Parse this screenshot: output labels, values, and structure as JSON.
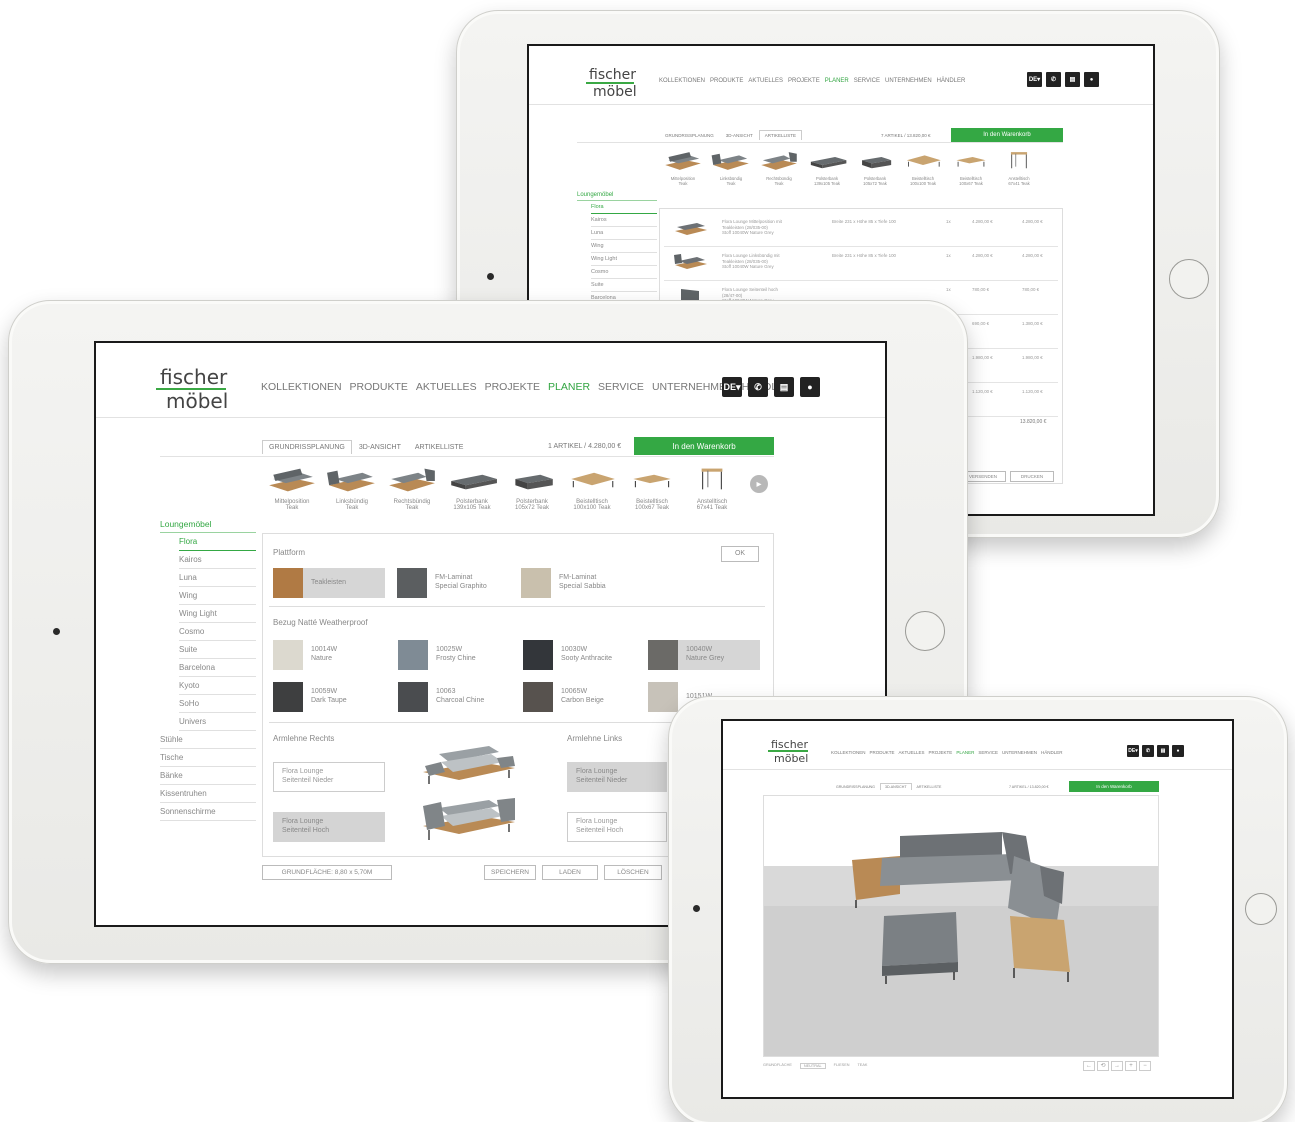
{
  "brand": {
    "line1": "fischer",
    "line2": "möbel",
    "accent": "#34a844"
  },
  "nav": {
    "items": [
      "KOLLEKTIONEN",
      "PRODUKTE",
      "AKTUELLES",
      "PROJEKTE",
      "PLANER",
      "SERVICE",
      "UNTERNEHMEN",
      "HÄNDLER"
    ],
    "active": "PLANER"
  },
  "header_buttons": {
    "lang": "DE▾",
    "phone_icon": "phone-icon",
    "cart_icon": "cart-icon",
    "user_icon": "user-icon"
  },
  "planner": {
    "tabs": [
      "GRUNDRISSPLANUNG",
      "3D-ANSICHT",
      "ARTIKELLISTE"
    ],
    "cart_count": "1 ARTIKEL / 4.280,00 €",
    "cart_button": "In den Warenkorb",
    "products": [
      {
        "line1": "Mittelposition",
        "line2": "Teak"
      },
      {
        "line1": "Linksbündig",
        "line2": "Teak"
      },
      {
        "line1": "Rechtsbündig",
        "line2": "Teak"
      },
      {
        "line1": "Polsterbank",
        "line2": "139x105 Teak"
      },
      {
        "line1": "Polsterbank",
        "line2": "105x72 Teak"
      },
      {
        "line1": "Beistelltisch",
        "line2": "100x100 Teak"
      },
      {
        "line1": "Beistelltisch",
        "line2": "100x67 Teak"
      },
      {
        "line1": "Anstelltisch",
        "line2": "67x41 Teak"
      }
    ],
    "categories": {
      "title": "Loungemöbel",
      "active_sub": "Flora",
      "subs": [
        "Flora",
        "Kairos",
        "Luna",
        "Wing",
        "Wing Light",
        "Cosmo",
        "Suite",
        "Barcelona",
        "Kyoto",
        "SoHo",
        "Univers"
      ],
      "others": [
        "Stühle",
        "Tische",
        "Bänke",
        "Kissentruhen",
        "Sonnenschirme"
      ]
    },
    "config": {
      "platform_title": "Plattform",
      "ok_label": "OK",
      "platform_options": [
        {
          "label": "Teakleisten",
          "color": "#b07a44",
          "selected": true
        },
        {
          "label": "FM-Laminat\nSpecial Graphito",
          "color": "#5b5e60",
          "selected": false
        },
        {
          "label": "FM-Laminat\nSpecial Sabbia",
          "color": "#c9c0ad",
          "selected": false
        }
      ],
      "fabric_title": "Bezug Natté Weatherproof",
      "fabric_options": [
        {
          "label": "10014W\nNature",
          "color": "#dcd9cf",
          "selected": false
        },
        {
          "label": "10025W\nFrosty Chine",
          "color": "#7f8b95",
          "selected": false
        },
        {
          "label": "10030W\nSooty Anthracite",
          "color": "#33363a",
          "selected": false
        },
        {
          "label": "10040W\nNature Grey",
          "color": "#6b6a67",
          "selected": true
        },
        {
          "label": "10059W\nDark Taupe",
          "color": "#3e3f40",
          "selected": false
        },
        {
          "label": "10063\nCharcoal Chine",
          "color": "#4a4c4f",
          "selected": false
        },
        {
          "label": "10065W\nCarbon Beige",
          "color": "#57524e",
          "selected": false
        },
        {
          "label": "10151W",
          "color": "#c7c2b9",
          "selected": false
        }
      ],
      "arm_right_title": "Armlehne Rechts",
      "arm_left_title": "Armlehne Links",
      "arm_right_options": [
        {
          "label": "Flora Lounge\nSeitenteil Nieder",
          "selected": false
        },
        {
          "label": "Flora Lounge\nSeitenteil Hoch",
          "selected": true
        }
      ],
      "arm_left_options": [
        {
          "label": "Flora Lounge\nSeitenteil Nieder",
          "selected": true
        },
        {
          "label": "Flora Lounge\nSeitenteil Hoch",
          "selected": false
        }
      ]
    },
    "bottom": {
      "area": "GRUNDFLÄCHE: 8,80 x 5,70M",
      "save": "SPEICHERN",
      "load": "LADEN",
      "delete": "LÖSCHEN"
    }
  },
  "article_list": {
    "tabs": [
      "GRUNDRISSPLANUNG",
      "3D-ANSICHT",
      "ARTIKELLISTE"
    ],
    "cart_count": "7 ARTIKEL / 13.820,00 €",
    "cart_button": "In den Warenkorb",
    "rows": [
      {
        "desc": "Flora Lounge Mittelposition mit\nTeakleisten (28/035-00)\nStoff 10040W Nature Grey",
        "dims": "Breite 231 x Höhe 85 x Tiefe 100",
        "qty": "1x",
        "price": "4.280,00 €",
        "total": "4.280,00 €"
      },
      {
        "desc": "Flora Lounge Linksbündig mit\nTeakleisten (28/035-00)\nStoff 10040W Nature Grey",
        "dims": "Breite 231 x Höhe 85 x Tiefe 100",
        "qty": "1x",
        "price": "4.280,00 €",
        "total": "4.280,00 €"
      },
      {
        "desc": "Flora Lounge Seitenteil hoch\n(28/47-00)\nStoff 10040W Nature Grey",
        "dims": "",
        "qty": "1x",
        "price": "780,00 €",
        "total": "780,00 €"
      },
      {
        "desc": "",
        "dims": "",
        "qty": "",
        "price": "690,00 €",
        "total": "1.380,00 €"
      },
      {
        "desc": "",
        "dims": "",
        "qty": "",
        "price": "1.980,00 €",
        "total": "1.980,00 €"
      },
      {
        "desc": "",
        "dims": "",
        "qty": "",
        "price": "1.120,00 €",
        "total": "1.120,00 €"
      }
    ],
    "sum": "13.820,00 €",
    "buttons": [
      "VERSENDEN",
      "DRUCKEN"
    ]
  },
  "view3d": {
    "tabs": [
      "GRUNDRISSPLANUNG",
      "3D-ANSICHT",
      "ARTIKELLISTE"
    ],
    "cart_count": "7 ARTIKEL / 13.820,00 €",
    "cart_button": "In den Warenkorb",
    "footer_left": [
      "GRUNDFLÄCHE",
      "NEUTRAL",
      "FLIESEN",
      "TEAK"
    ],
    "footer_icons": [
      "arrow-left-icon",
      "rotate-icon",
      "arrow-right-icon",
      "zoom-in-icon",
      "zoom-out-icon"
    ],
    "footer_glyphs": [
      "←",
      "⟲",
      "→",
      "+",
      "−"
    ]
  }
}
